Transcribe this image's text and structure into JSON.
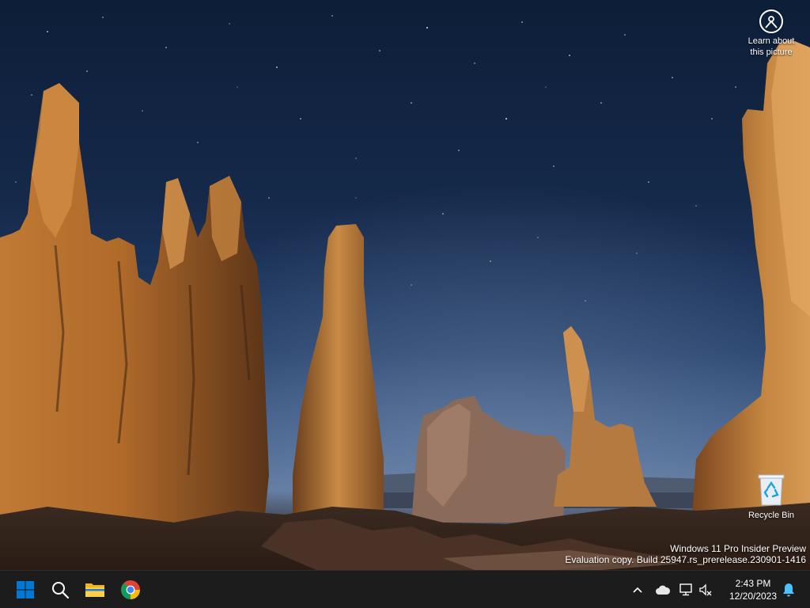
{
  "desktop": {
    "learn_label_line1": "Learn about",
    "learn_label_line2": "this picture",
    "recycle_bin_label": "Recycle Bin",
    "watermark_line1": "Windows 11 Pro Insider Preview",
    "watermark_line2": "Evaluation copy. Build 25947.rs_prerelease.230901-1416"
  },
  "taskbar": {
    "pinned": [
      {
        "name": "Start",
        "icon": "windows-logo-icon"
      },
      {
        "name": "Search",
        "icon": "search-icon"
      },
      {
        "name": "File Explorer",
        "icon": "folder-icon"
      },
      {
        "name": "Google Chrome",
        "icon": "chrome-icon"
      }
    ],
    "tray": {
      "icons": [
        "chevron-up-icon",
        "cloud-icon",
        "network-icon",
        "volume-muted-icon",
        "notification-bell-icon"
      ],
      "time": "2:43 PM",
      "date": "12/20/2023"
    }
  },
  "colors": {
    "taskbar_bg": "#1c1c1c",
    "windows_blue": "#0078d4",
    "folder_yellow": "#f2b31b",
    "notification_accent": "#4cc2ff"
  }
}
